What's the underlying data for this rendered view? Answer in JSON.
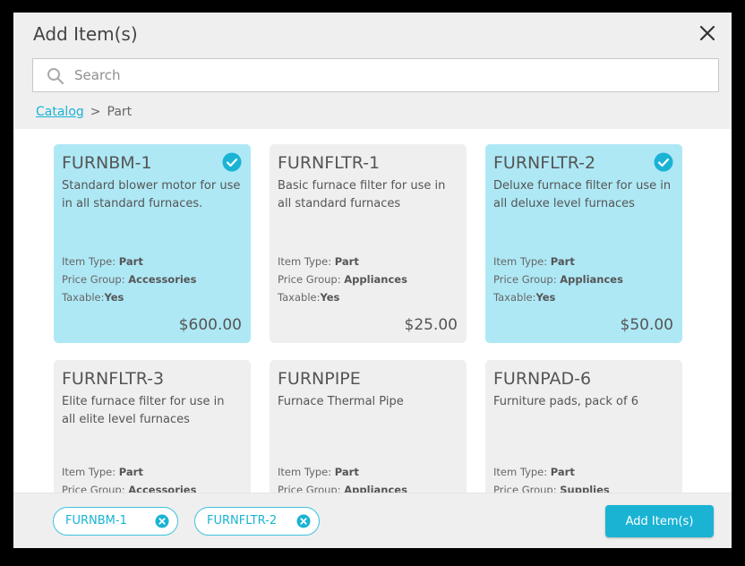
{
  "dialog": {
    "title": "Add Item(s)"
  },
  "search": {
    "placeholder": "Search",
    "value": ""
  },
  "breadcrumb": {
    "root": "Catalog",
    "separator": ">",
    "current": "Part"
  },
  "labels": {
    "item_type": "Item Type:",
    "price_group": "Price Group:",
    "taxable": "Taxable:"
  },
  "items": [
    {
      "code": "FURNBM-1",
      "description": "Standard blower motor for use in all standard furnaces.",
      "item_type": "Part",
      "price_group": "Accessories",
      "taxable": "Yes",
      "price": "$600.00",
      "selected": true
    },
    {
      "code": "FURNFLTR-1",
      "description": "Basic furnace filter for use in all standard furnaces",
      "item_type": "Part",
      "price_group": "Appliances",
      "taxable": "Yes",
      "price": "$25.00",
      "selected": false
    },
    {
      "code": "FURNFLTR-2",
      "description": "Deluxe furnace filter for use in all deluxe level furnaces",
      "item_type": "Part",
      "price_group": "Appliances",
      "taxable": "Yes",
      "price": "$50.00",
      "selected": true
    },
    {
      "code": "FURNFLTR-3",
      "description": "Elite furnace filter for use in all elite level furnaces",
      "item_type": "Part",
      "price_group": "Accessories",
      "selected": false
    },
    {
      "code": "FURNPIPE",
      "description": "Furnace Thermal Pipe",
      "item_type": "Part",
      "price_group": "Appliances",
      "selected": false
    },
    {
      "code": "FURNPAD-6",
      "description": "Furniture pads, pack of 6",
      "item_type": "Part",
      "price_group": "Supplies",
      "selected": false
    }
  ],
  "selected_chips": [
    "FURNBM-1",
    "FURNFLTR-2"
  ],
  "footer": {
    "add_button": "Add Item(s)"
  },
  "colors": {
    "accent": "#1ab3d4",
    "selected_card": "#aee8f5",
    "card": "#efefef"
  }
}
